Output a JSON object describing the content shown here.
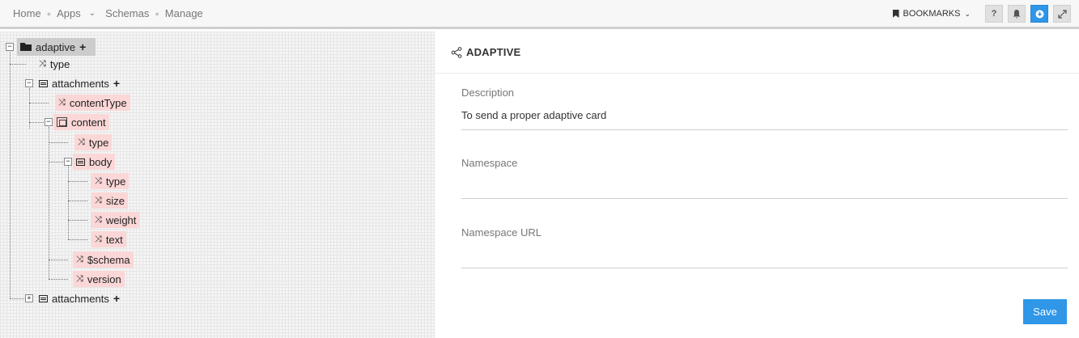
{
  "nav": {
    "breadcrumbs": [
      "Home",
      "Apps",
      "Schemas",
      "Manage"
    ],
    "bookmarks_label": "BOOKMARKS",
    "tools": [
      "question-icon",
      "bell-icon",
      "download-icon",
      "expand-icon"
    ]
  },
  "tree": {
    "nodes": [
      {
        "id": "adaptive",
        "label": "adaptive",
        "icon": "folder-open-icon",
        "add": true
      },
      {
        "id": "type",
        "label": "type",
        "icon": "shuffle-icon"
      },
      {
        "id": "attachments1",
        "label": "attachments",
        "icon": "list-icon",
        "add": true
      },
      {
        "id": "contentType",
        "label": "contentType",
        "icon": "shuffle-icon"
      },
      {
        "id": "content",
        "label": "content",
        "icon": "object-icon"
      },
      {
        "id": "content_type",
        "label": "type",
        "icon": "shuffle-icon"
      },
      {
        "id": "body",
        "label": "body",
        "icon": "list-icon"
      },
      {
        "id": "body_type",
        "label": "type",
        "icon": "shuffle-icon"
      },
      {
        "id": "size",
        "label": "size",
        "icon": "shuffle-icon"
      },
      {
        "id": "weight",
        "label": "weight",
        "icon": "shuffle-icon"
      },
      {
        "id": "text",
        "label": "text",
        "icon": "shuffle-icon"
      },
      {
        "id": "schema",
        "label": "$schema",
        "icon": "shuffle-icon"
      },
      {
        "id": "version",
        "label": "version",
        "icon": "shuffle-icon"
      },
      {
        "id": "attachments2",
        "label": "attachments",
        "icon": "list-icon",
        "add": true
      }
    ],
    "toggle_collapse": "−",
    "toggle_expand": "+",
    "add_glyph": "+"
  },
  "detail": {
    "title": "ADAPTIVE",
    "fields": {
      "description": {
        "label": "Description",
        "value": "To send a proper adaptive card"
      },
      "namespace": {
        "label": "Namespace",
        "value": ""
      },
      "namespace_url": {
        "label": "Namespace URL",
        "value": ""
      }
    },
    "save_label": "Save"
  },
  "colors": {
    "accent": "#2f96e8",
    "node_highlight": "#fbd7d7",
    "root_selected": "#cccccc"
  }
}
